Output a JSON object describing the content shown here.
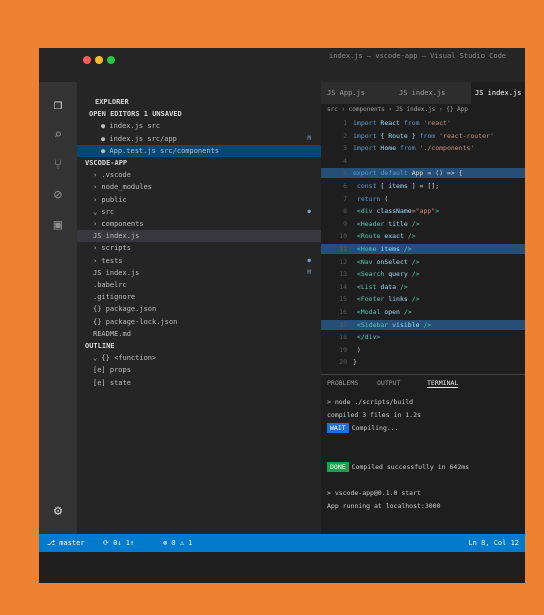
{
  "window": {
    "title": "index.js — vscode-app — Visual Studio Code",
    "traffic_colors": [
      "#ff5f57",
      "#febc2e",
      "#28c840"
    ]
  },
  "activity_bar": {
    "items": [
      {
        "name": "files-icon",
        "glyph": "❐"
      },
      {
        "name": "search-icon",
        "glyph": "⌕"
      },
      {
        "name": "source-control-icon",
        "glyph": "⑂"
      },
      {
        "name": "debug-icon",
        "glyph": "⊘"
      },
      {
        "name": "extensions-icon",
        "glyph": "▣"
      }
    ],
    "settings_glyph": "⚙"
  },
  "sidebar": {
    "explorer_title": "EXPLORER",
    "open_editors_header": "OPEN EDITORS 1 UNSAVED",
    "open_editors": [
      {
        "label": "● index.js src",
        "badge": ""
      },
      {
        "label": "● index.js src/app",
        "badge": "M"
      },
      {
        "label": "● App.test.js src/components",
        "badge": ""
      }
    ],
    "project_header": "VSCODE-APP",
    "tree": [
      {
        "label": "› .vscode",
        "badge": "",
        "state": ""
      },
      {
        "label": "› node_modules",
        "badge": "",
        "state": ""
      },
      {
        "label": "› public",
        "badge": "",
        "state": ""
      },
      {
        "label": "⌄ src",
        "badge": "●",
        "state": ""
      },
      {
        "label": "  › components",
        "badge": "",
        "state": ""
      },
      {
        "label": "  JS index.js",
        "badge": "",
        "state": "sel"
      },
      {
        "label": "› scripts",
        "badge": "",
        "state": ""
      },
      {
        "label": "› tests",
        "badge": "●",
        "state": ""
      },
      {
        "label": "  JS index.js",
        "badge": "M",
        "state": ""
      },
      {
        "label": "  .babelrc",
        "badge": "",
        "state": ""
      },
      {
        "label": "  .gitignore",
        "badge": "",
        "state": ""
      },
      {
        "label": "  {} package.json",
        "badge": "",
        "state": ""
      },
      {
        "label": "  {} package-lock.json",
        "badge": "",
        "state": ""
      },
      {
        "label": "  README.md",
        "badge": "",
        "state": ""
      }
    ],
    "outline_header": "OUTLINE",
    "outline": [
      {
        "label": "⌄ {} <function>",
        "badge": "",
        "state": ""
      },
      {
        "label": "  [e] props",
        "badge": "",
        "state": ""
      },
      {
        "label": "  [e] state",
        "badge": "",
        "state": ""
      }
    ]
  },
  "editor": {
    "tabs": [
      {
        "label": "JS App.js",
        "active": false
      },
      {
        "label": "JS index.js",
        "active": false
      },
      {
        "label": "JS index.js",
        "active": true
      }
    ],
    "breadcrumb": "src › components › JS index.js › {} App",
    "first_line_number": 1,
    "code": [
      [
        {
          "c": "kw",
          "t": "import "
        },
        {
          "c": "var",
          "t": "React"
        },
        {
          "c": "kw",
          "t": " from "
        },
        {
          "c": "str",
          "t": "'react'"
        }
      ],
      [
        {
          "c": "kw",
          "t": "import "
        },
        {
          "c": "var",
          "t": "{ Route }"
        },
        {
          "c": "kw",
          "t": " from "
        },
        {
          "c": "str",
          "t": "'react-router'"
        }
      ],
      [
        {
          "c": "kw",
          "t": "import "
        },
        {
          "c": "var",
          "t": "Home"
        },
        {
          "c": "kw",
          "t": " from "
        },
        {
          "c": "str",
          "t": "'./components'"
        }
      ],
      [
        {
          "c": "pl",
          "t": ""
        }
      ],
      [
        {
          "c": "kw",
          "t": "export default "
        },
        {
          "c": "fn",
          "t": "App"
        },
        {
          "c": "pl",
          "t": " = () => {"
        }
      ],
      [
        {
          "c": "kw",
          "t": "  const "
        },
        {
          "c": "var",
          "t": "[ items ]"
        },
        {
          "c": "pl",
          "t": " = [];"
        }
      ],
      [
        {
          "c": "kw",
          "t": "  return "
        },
        {
          "c": "pl",
          "t": "("
        }
      ],
      [
        {
          "c": "tag",
          "t": "    <div "
        },
        {
          "c": "var",
          "t": "className"
        },
        {
          "c": "str",
          "t": "=\"app\""
        },
        {
          "c": "tag",
          "t": ">"
        }
      ],
      [
        {
          "c": "tag",
          "t": "      <Header "
        },
        {
          "c": "var",
          "t": "title"
        },
        {
          "c": "tag",
          "t": " />"
        }
      ],
      [
        {
          "c": "tag",
          "t": "      <Route "
        },
        {
          "c": "var",
          "t": "exact"
        },
        {
          "c": "tag",
          "t": " />"
        }
      ],
      [
        {
          "c": "tag",
          "t": "        <Home "
        },
        {
          "c": "var",
          "t": "items"
        },
        {
          "c": "tag",
          "t": " />"
        }
      ],
      [
        {
          "c": "tag",
          "t": "        <Nav "
        },
        {
          "c": "var",
          "t": "onSelect"
        },
        {
          "c": "tag",
          "t": " />"
        }
      ],
      [
        {
          "c": "tag",
          "t": "        <Search "
        },
        {
          "c": "var",
          "t": "query"
        },
        {
          "c": "tag",
          "t": " />"
        }
      ],
      [
        {
          "c": "tag",
          "t": "        <List "
        },
        {
          "c": "var",
          "t": "data"
        },
        {
          "c": "tag",
          "t": " />"
        }
      ],
      [
        {
          "c": "tag",
          "t": "      <Footer "
        },
        {
          "c": "var",
          "t": "links"
        },
        {
          "c": "tag",
          "t": " />"
        }
      ],
      [
        {
          "c": "tag",
          "t": "      <Modal "
        },
        {
          "c": "var",
          "t": "open"
        },
        {
          "c": "tag",
          "t": " />"
        }
      ],
      [
        {
          "c": "tag",
          "t": "    <Sidebar "
        },
        {
          "c": "var",
          "t": "visible"
        },
        {
          "c": "tag",
          "t": " />"
        }
      ],
      [
        {
          "c": "tag",
          "t": "    </div>"
        }
      ],
      [
        {
          "c": "pl",
          "t": "  )"
        }
      ],
      [
        {
          "c": "pl",
          "t": "}"
        }
      ]
    ],
    "highlight_lines": [
      5,
      11,
      17
    ]
  },
  "panel": {
    "tabs": [
      {
        "label": "PROBLEMS",
        "active": false
      },
      {
        "label": "OUTPUT",
        "active": false
      },
      {
        "label": "TERMINAL",
        "active": true
      }
    ],
    "terminal": [
      {
        "badge": "",
        "badge_color": "",
        "text": "> node  ./scripts/build"
      },
      {
        "badge": "",
        "badge_color": "",
        "text": "compiled 3 files in 1.2s"
      },
      {
        "badge": "WAIT",
        "badge_color": "#1e6fd9",
        "text": "Compiling..."
      },
      {
        "badge": "",
        "badge_color": "",
        "text": ""
      },
      {
        "badge": "",
        "badge_color": "",
        "text": ""
      },
      {
        "badge": "DONE",
        "badge_color": "#16a34a",
        "text": "Compiled successfully in 642ms"
      },
      {
        "badge": "",
        "badge_color": "",
        "text": ""
      },
      {
        "badge": "",
        "badge_color": "",
        "text": "> vscode-app@0.1.0 start"
      },
      {
        "badge": "",
        "badge_color": "",
        "text": "  App running at  localhost:3000"
      }
    ]
  },
  "statusbar": {
    "branch": "⎇ master",
    "sync": "⟳ 0↓ 1↑",
    "problems": "⊗ 0  ⚠ 1",
    "right": "Ln 8, Col 12"
  }
}
